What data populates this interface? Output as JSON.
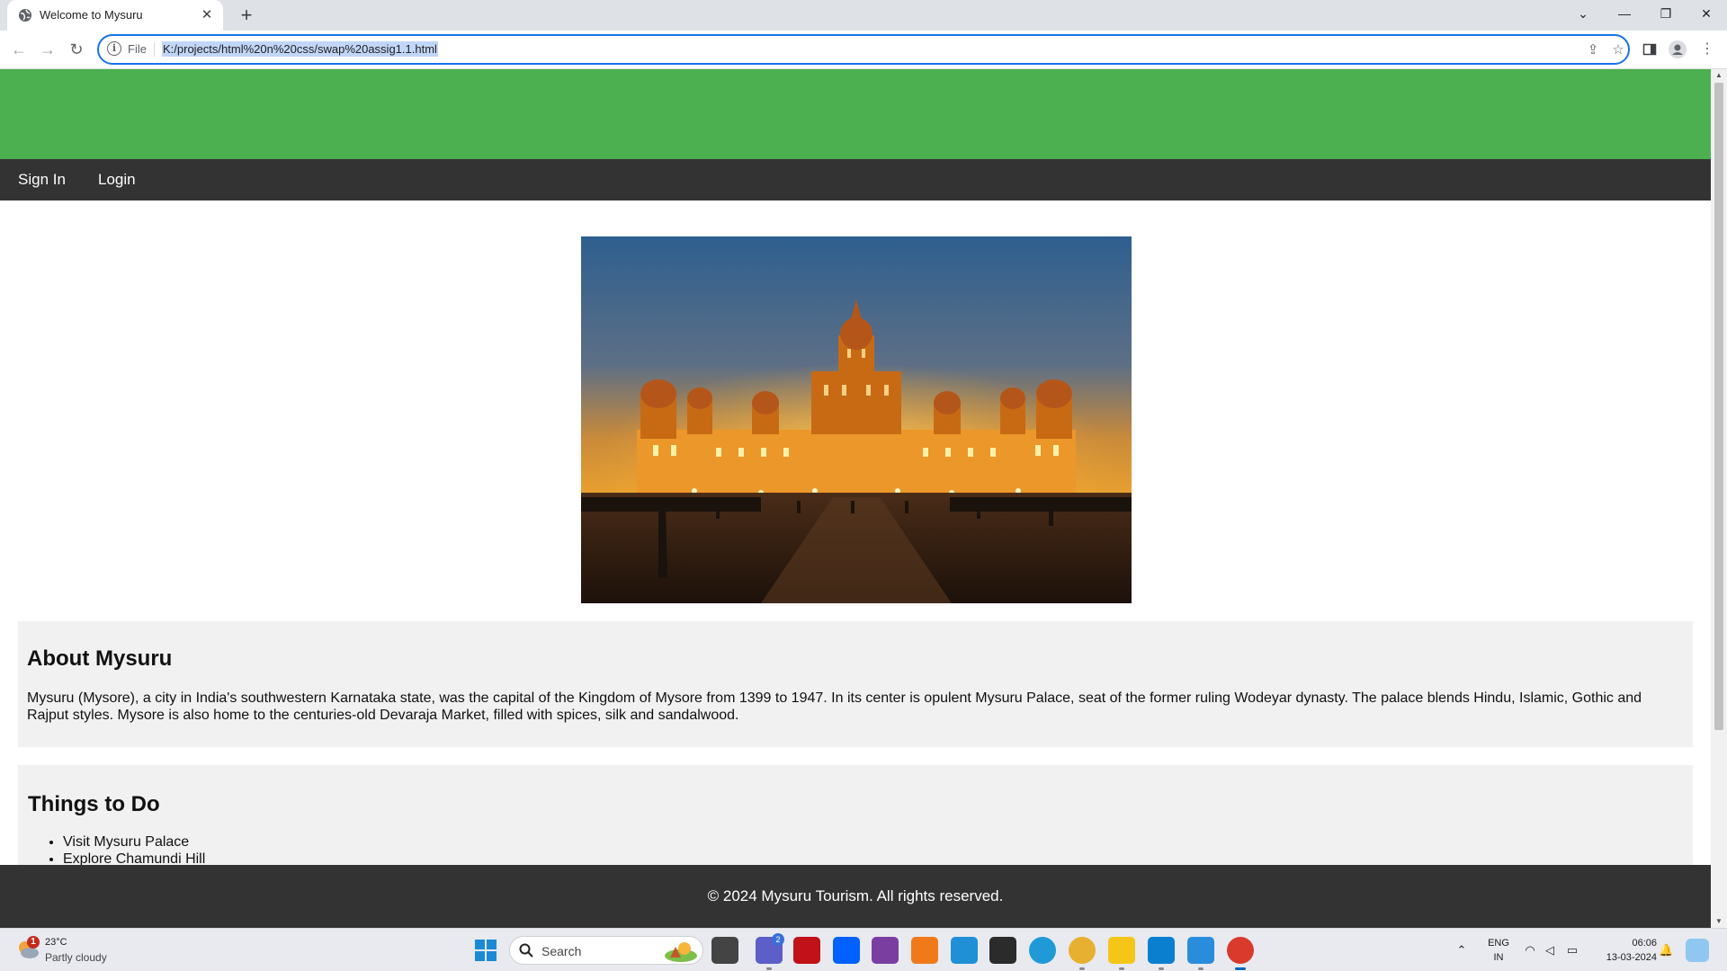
{
  "browser": {
    "tab_title": "Welcome to Mysuru",
    "address_scheme": "File",
    "address_url": "K:/projects/html%20n%20css/swap%20assig1.1.html"
  },
  "site": {
    "nav": [
      "Sign In",
      "Login"
    ],
    "hero_image": "mysuru-palace-illuminated-at-dusk",
    "about": {
      "heading": "About Mysuru",
      "text": "Mysuru (Mysore), a city in India's southwestern Karnataka state, was the capital of the Kingdom of Mysore from 1399 to 1947. In its center is opulent Mysuru Palace, seat of the former ruling Wodeyar dynasty. The palace blends Hindu, Islamic, Gothic and Rajput styles. Mysore is also home to the centuries-old Devaraja Market, filled with spices, silk and sandalwood."
    },
    "things": {
      "heading": "Things to Do",
      "items": [
        "Visit Mysuru Palace",
        "Explore Chamundi Hill"
      ]
    },
    "footer": "© 2024 Mysuru Tourism. All rights reserved.",
    "colors": {
      "header": "#4caf50",
      "nav": "#333333",
      "section": "#f1f1f1"
    }
  },
  "taskbar": {
    "weather_badge": "1",
    "weather_temp": "23°C",
    "weather_condition": "Partly cloudy",
    "search_placeholder": "Search",
    "teams_badge": "2",
    "language": "ENG",
    "region": "IN",
    "time": "06:06",
    "date": "13-03-2024"
  }
}
